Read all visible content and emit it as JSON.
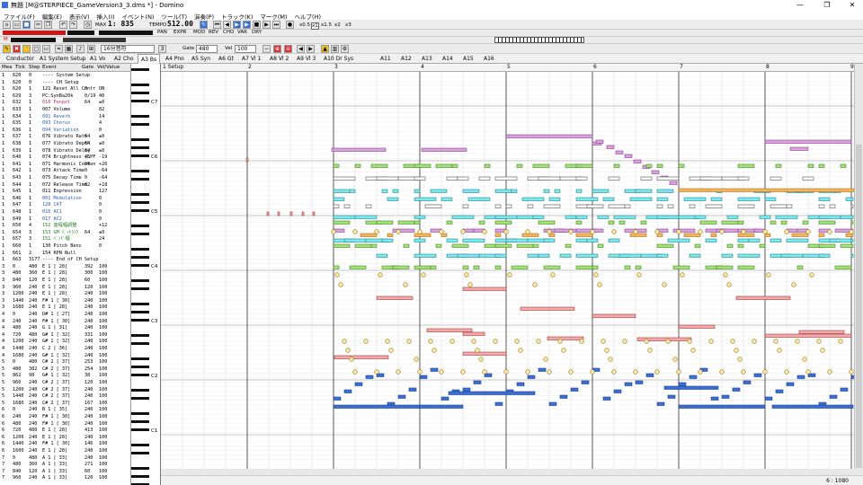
{
  "window": {
    "title": "無題 [M@STERPIECE_GameVersion3_3.dms *] - Domino",
    "minimize": "—",
    "maximize": "❐",
    "close": "✕"
  },
  "menu": [
    "ファイル(F)",
    "編集(E)",
    "表示(V)",
    "挿入(I)",
    "イベント(N)",
    "ツール(T)",
    "演奏(P)",
    "トラック(K)",
    "マーク(M)",
    "ヘルプ(H)"
  ],
  "transport": {
    "position": "1: 835",
    "tempo_label": "TEMPO",
    "tempo": "512.00",
    "max_label": "MAX",
    "meter_labels": [
      "PAN",
      "EXPR",
      "MOD",
      "REV",
      "CHO",
      "VAR",
      "DRY"
    ],
    "zoom_buttons": [
      "x0.5",
      "x1",
      "x1.5",
      "x2",
      "x3"
    ],
    "mute_label": "M"
  },
  "editbar": {
    "note_length": "16分音符",
    "gate_label": "Gate",
    "gate": "480",
    "vel_label": "Vel",
    "vel": "100"
  },
  "tabs": [
    "Conductor",
    "A1 System Setup",
    "A1 Vo",
    "A2 Cho",
    "A3 Bs",
    "A4 Pno",
    "A5 Syn",
    "A6 Gt",
    "A7 Vl 1",
    "A8 Vl 2",
    "A9 Vl 3",
    "A10 Dr Sys",
    "A11",
    "A12",
    "A13",
    "A14",
    "A15",
    "A16"
  ],
  "selected_tab": "A3 Bs",
  "event_list": {
    "headers": [
      "Mea",
      "Tick",
      "Step",
      "Event",
      "Gate",
      "Vel/Value"
    ],
    "rows": [
      [
        "1",
        "620",
        "0",
        "---- System Setup",
        "",
        ""
      ],
      [
        "1",
        "620",
        "0",
        "---- CH Setup",
        "",
        ""
      ],
      [
        "1",
        "620",
        "1",
        "121 Reset All Contr",
        "0",
        "ON"
      ],
      [
        "1",
        "629",
        "3",
        "PC:SynBa20k",
        "0/19",
        "40"
      ],
      [
        "1",
        "632",
        "1",
        "010 Panpot",
        "64",
        "±0"
      ],
      [
        "1",
        "633",
        "1",
        "007 Volume",
        "",
        "82"
      ],
      [
        "1",
        "634",
        "1",
        "091 Reverb",
        "",
        "14"
      ],
      [
        "1",
        "635",
        "1",
        "093 Chorus",
        "",
        "4"
      ],
      [
        "1",
        "636",
        "1",
        "094 Variation",
        "",
        "0"
      ],
      [
        "1",
        "637",
        "1",
        "076 Vibrato Rate",
        "64",
        "±0"
      ],
      [
        "1",
        "638",
        "1",
        "077 Vibrato Depth",
        "64",
        "±0"
      ],
      [
        "1",
        "639",
        "1",
        "078 Vibrato Delay",
        "64",
        "±0"
      ],
      [
        "1",
        "640",
        "1",
        "074 Brightness (LPF",
        "45",
        "-19"
      ],
      [
        "1",
        "641",
        "1",
        "071 Harmonic Conten",
        "90",
        "+26"
      ],
      [
        "1",
        "642",
        "1",
        "073 Attack Time",
        "0",
        "-64"
      ],
      [
        "1",
        "643",
        "1",
        "075 Decay Time",
        "0",
        "-64"
      ],
      [
        "1",
        "644",
        "1",
        "072 Release Time",
        "82",
        "+18"
      ],
      [
        "1",
        "645",
        "1",
        "011 Expression",
        "",
        "127"
      ],
      [
        "1",
        "646",
        "1",
        "001 Modulation",
        "",
        "0"
      ],
      [
        "1",
        "647",
        "1",
        "128 CAT",
        "",
        "0"
      ],
      [
        "1",
        "648",
        "1",
        "016 AC1",
        "",
        "0"
      ],
      [
        "1",
        "649",
        "1",
        "017 AC2",
        "",
        "0"
      ],
      [
        "1",
        "650",
        "4",
        "152 音程幅調整",
        "",
        "+12"
      ],
      [
        "1",
        "654",
        "3",
        "153 GM ﾊﾞｰﾄﾗﾝｸ",
        "64",
        "±0"
      ],
      [
        "1",
        "657",
        "3",
        "151 ﾍﾞﾝﾄﾞ幅",
        "",
        "24"
      ],
      [
        "1",
        "660",
        "1",
        "130 Pitch Benc",
        "",
        "0"
      ],
      [
        "1",
        "661",
        "2",
        "154 RPN Null",
        "",
        ""
      ],
      [
        "1",
        "663",
        "3177",
        "---- End of CH Setup",
        "",
        ""
      ],
      [
        "3",
        "0",
        "480",
        "E 1 [ 28]",
        "392",
        "100"
      ],
      [
        "3",
        "480",
        "360",
        "E 1 [ 28]",
        "300",
        "100"
      ],
      [
        "3",
        "840",
        "120",
        "E 1 [ 28]",
        "60",
        "100"
      ],
      [
        "3",
        "960",
        "240",
        "E 1 [ 28]",
        "120",
        "100"
      ],
      [
        "3",
        "1200",
        "240",
        "E 1 [ 28]",
        "240",
        "100"
      ],
      [
        "3",
        "1440",
        "240",
        "F# 1 [ 30]",
        "240",
        "100"
      ],
      [
        "3",
        "1680",
        "240",
        "E 1 [ 28]",
        "240",
        "100"
      ],
      [
        "4",
        "0",
        "240",
        "D# 1 [ 27]",
        "240",
        "100"
      ],
      [
        "4",
        "240",
        "240",
        "F# 1 [ 30]",
        "240",
        "100"
      ],
      [
        "4",
        "480",
        "240",
        "G 1 [ 31]",
        "240",
        "100"
      ],
      [
        "4",
        "720",
        "480",
        "G# 1 [ 32]",
        "331",
        "100"
      ],
      [
        "4",
        "1200",
        "240",
        "G# 1 [ 32]",
        "240",
        "100"
      ],
      [
        "4",
        "1440",
        "240",
        "C 2 [ 36]",
        "240",
        "100"
      ],
      [
        "4",
        "1680",
        "240",
        "G# 1 [ 32]",
        "240",
        "100"
      ],
      [
        "5",
        "0",
        "480",
        "C# 2 [ 37]",
        "253",
        "100"
      ],
      [
        "5",
        "480",
        "382",
        "C# 2 [ 37]",
        "254",
        "100"
      ],
      [
        "5",
        "862",
        "98",
        "G# 1 [ 32]",
        "38",
        "100"
      ],
      [
        "5",
        "960",
        "240",
        "C# 2 [ 37]",
        "120",
        "100"
      ],
      [
        "5",
        "1200",
        "240",
        "C# 2 [ 37]",
        "240",
        "100"
      ],
      [
        "5",
        "1440",
        "240",
        "C# 2 [ 37]",
        "240",
        "100"
      ],
      [
        "5",
        "1680",
        "240",
        "C# 2 [ 37]",
        "167",
        "100"
      ],
      [
        "6",
        "0",
        "240",
        "B 1 [ 35]",
        "240",
        "100"
      ],
      [
        "6",
        "240",
        "240",
        "F# 1 [ 30]",
        "240",
        "100"
      ],
      [
        "6",
        "480",
        "240",
        "F# 1 [ 30]",
        "240",
        "100"
      ],
      [
        "6",
        "720",
        "480",
        "E 1 [ 28]",
        "413",
        "100"
      ],
      [
        "6",
        "1200",
        "240",
        "E 1 [ 28]",
        "240",
        "100"
      ],
      [
        "6",
        "1440",
        "240",
        "F# 1 [ 30]",
        "146",
        "100"
      ],
      [
        "6",
        "1600",
        "240",
        "E 1 [ 28]",
        "240",
        "100"
      ],
      [
        "7",
        "0",
        "480",
        "A 1 [ 33]",
        "240",
        "100"
      ],
      [
        "7",
        "480",
        "360",
        "A 1 [ 33]",
        "271",
        "100"
      ],
      [
        "7",
        "840",
        "120",
        "A 1 [ 33]",
        "60",
        "100"
      ],
      [
        "7",
        "960",
        "240",
        "A 1 [ 33]",
        "120",
        "100"
      ]
    ]
  },
  "octave_labels": [
    "C7",
    "C6",
    "C5",
    "C4",
    "C3",
    "C2",
    "C1"
  ],
  "ruler": {
    "setup_label": "1 Setup",
    "bars": [
      "2",
      "3",
      "4",
      "5",
      "6",
      "7",
      "8",
      "9"
    ]
  },
  "status": {
    "position": "6 : 1080"
  }
}
